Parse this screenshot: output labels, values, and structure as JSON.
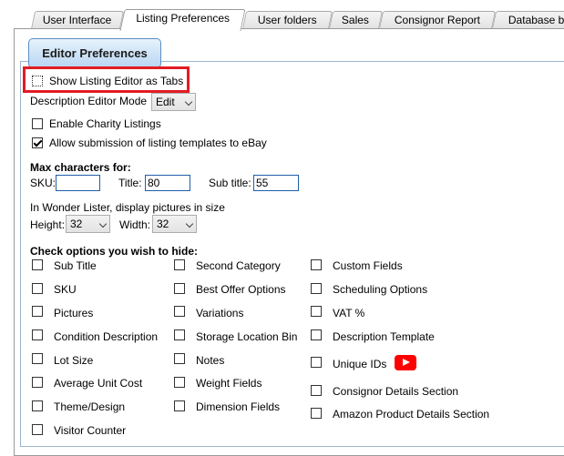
{
  "tabs": [
    {
      "label": "User Interface"
    },
    {
      "label": "Listing Preferences"
    },
    {
      "label": "User folders"
    },
    {
      "label": "Sales"
    },
    {
      "label": "Consignor Report"
    },
    {
      "label": "Database ba"
    }
  ],
  "active_tab": "Listing Preferences",
  "group_label": "Editor Preferences",
  "show_tabs_label": "Show Listing Editor as Tabs",
  "desc_mode": {
    "label": "Description Editor Mode",
    "value": "Edit"
  },
  "charity_label": "Enable Charity Listings",
  "allow_submit_label": "Allow submission of listing templates to eBay",
  "max_chars": {
    "heading": "Max characters for:",
    "sku_label": "SKU:",
    "sku_value": "",
    "title_label": "Title:",
    "title_value": "80",
    "subtitle_label": "Sub title:",
    "subtitle_value": "55"
  },
  "pictures": {
    "label": "In Wonder Lister, display pictures in size",
    "height_label": "Height:",
    "height_value": "32",
    "width_label": "Width:",
    "width_value": "32"
  },
  "hide_heading": "Check options you wish to hide:",
  "hide_col1": [
    "Sub Title",
    "SKU",
    "Pictures",
    "Condition Description",
    "Lot Size",
    "Average Unit Cost",
    "Theme/Design",
    "Visitor Counter"
  ],
  "hide_col2": [
    "Second Category",
    "Best Offer Options",
    "Variations",
    "Storage Location Bin",
    "Notes",
    "Weight Fields",
    "Dimension Fields"
  ],
  "hide_col3": [
    "Custom Fields",
    "Scheduling Options",
    "VAT %",
    "Description Template",
    "Unique IDs",
    "Consignor Details Section",
    "Amazon Product Details Section"
  ],
  "icons": {
    "video": "youtube-play-icon",
    "checkbox_checked": "checkmark-icon",
    "dropdown": "chevron-down-icon"
  },
  "colors": {
    "highlight": "#e31c23",
    "accent": "#5c8fc4",
    "youtube": "#ff0000"
  }
}
